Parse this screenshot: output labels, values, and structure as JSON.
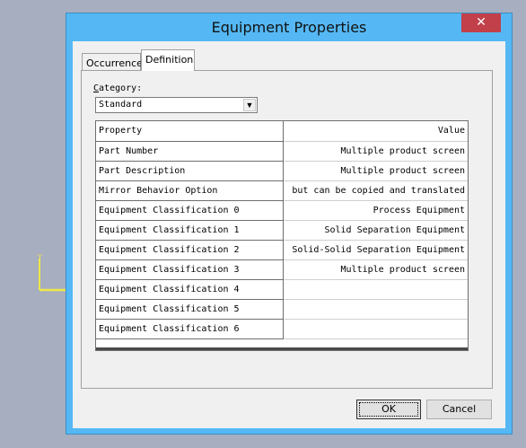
{
  "background_color": "#a6aebf",
  "axis_triad": {
    "y_label": "Y",
    "color": "#f0e64a"
  },
  "dialog": {
    "title": "Equipment Properties",
    "close_glyph": "✕",
    "tabs": [
      {
        "label": "Occurrence",
        "active": false
      },
      {
        "label": "Definition",
        "active": true
      }
    ],
    "category": {
      "label_hotkey": "C",
      "label_rest": "ategory:",
      "selected": "Standard",
      "arrow": "▼"
    },
    "grid": {
      "header": {
        "property": "Property",
        "value": "Value"
      },
      "rows": [
        {
          "property": "Part Number",
          "value": "Multiple product screen"
        },
        {
          "property": "Part Description",
          "value": "Multiple product screen"
        },
        {
          "property": "Mirror Behavior Option",
          "value": "but can be copied and translated"
        },
        {
          "property": "Equipment Classification 0",
          "value": "Process Equipment"
        },
        {
          "property": "Equipment Classification 1",
          "value": "Solid Separation Equipment"
        },
        {
          "property": "Equipment Classification 2",
          "value": "Solid-Solid Separation Equipment"
        },
        {
          "property": "Equipment Classification 3",
          "value": "Multiple product screen"
        },
        {
          "property": "Equipment Classification 4",
          "value": ""
        },
        {
          "property": "Equipment Classification 5",
          "value": ""
        },
        {
          "property": "Equipment Classification 6",
          "value": ""
        }
      ]
    },
    "buttons": {
      "ok": "OK",
      "cancel": "Cancel"
    },
    "colors": {
      "titlebar": "#55b8f5",
      "close": "#c2404a"
    }
  }
}
